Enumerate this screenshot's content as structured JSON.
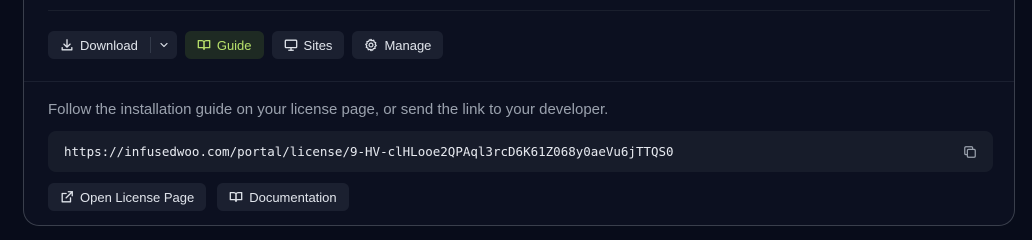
{
  "toolbar": {
    "download_label": "Download",
    "guide_label": "Guide",
    "sites_label": "Sites",
    "manage_label": "Manage"
  },
  "help_text": "Follow the installation guide on your license page, or send the link to your developer.",
  "license_url": "https://infusedwoo.com/portal/license/9-HV-clHLooe2QPAql3rcD6K61Z068y0aeVu6jTTQS0",
  "links": {
    "open_license_label": "Open License Page",
    "documentation_label": "Documentation"
  },
  "colors": {
    "accent_guide_text": "#b7e06a",
    "accent_guide_bg": "#1e2a23",
    "button_bg": "#1b2030",
    "page_bg": "#080c1a"
  },
  "icons": [
    "download-icon",
    "chevron-down-icon",
    "book-open-icon",
    "monitor-icon",
    "gear-icon",
    "copy-icon",
    "external-link-icon"
  ]
}
